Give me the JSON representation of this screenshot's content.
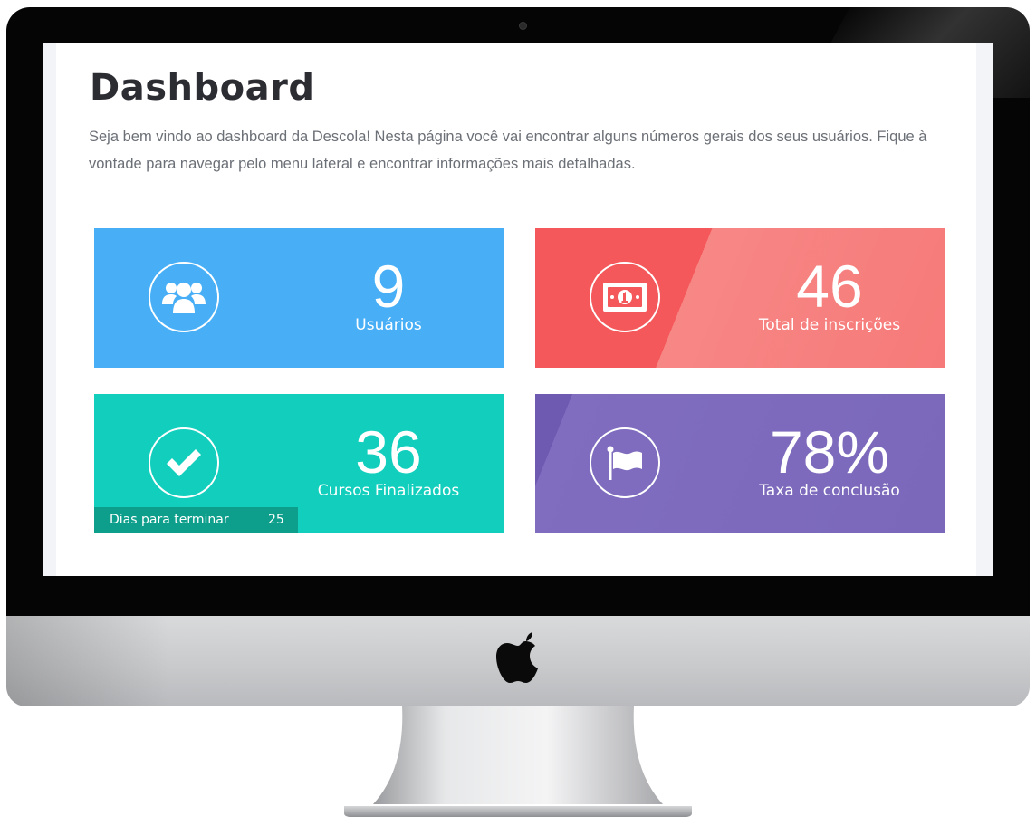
{
  "dashboard": {
    "title": "Dashboard",
    "intro": "Seja bem vindo ao dashboard da Descola! Nesta página você vai encontrar alguns números gerais dos seus usuários. Fique à vontade para navegar pelo menu lateral e encontrar informações mais detalhadas."
  },
  "cards": [
    {
      "value": "9",
      "label": "Usuários",
      "icon": "users-icon",
      "color": "#48aff7"
    },
    {
      "value": "46",
      "label": "Total de inscrições",
      "icon": "money-icon",
      "color": "#f4585a"
    },
    {
      "value": "36",
      "label": "Cursos Finalizados",
      "icon": "check-icon",
      "color": "#12cfbd",
      "footer": {
        "label": "Dias para terminar",
        "value": "25",
        "color": "#0d9f8b"
      }
    },
    {
      "value": "78%",
      "label": "Taxa de conclusão",
      "icon": "flag-icon",
      "color": "#7b68ba"
    }
  ]
}
